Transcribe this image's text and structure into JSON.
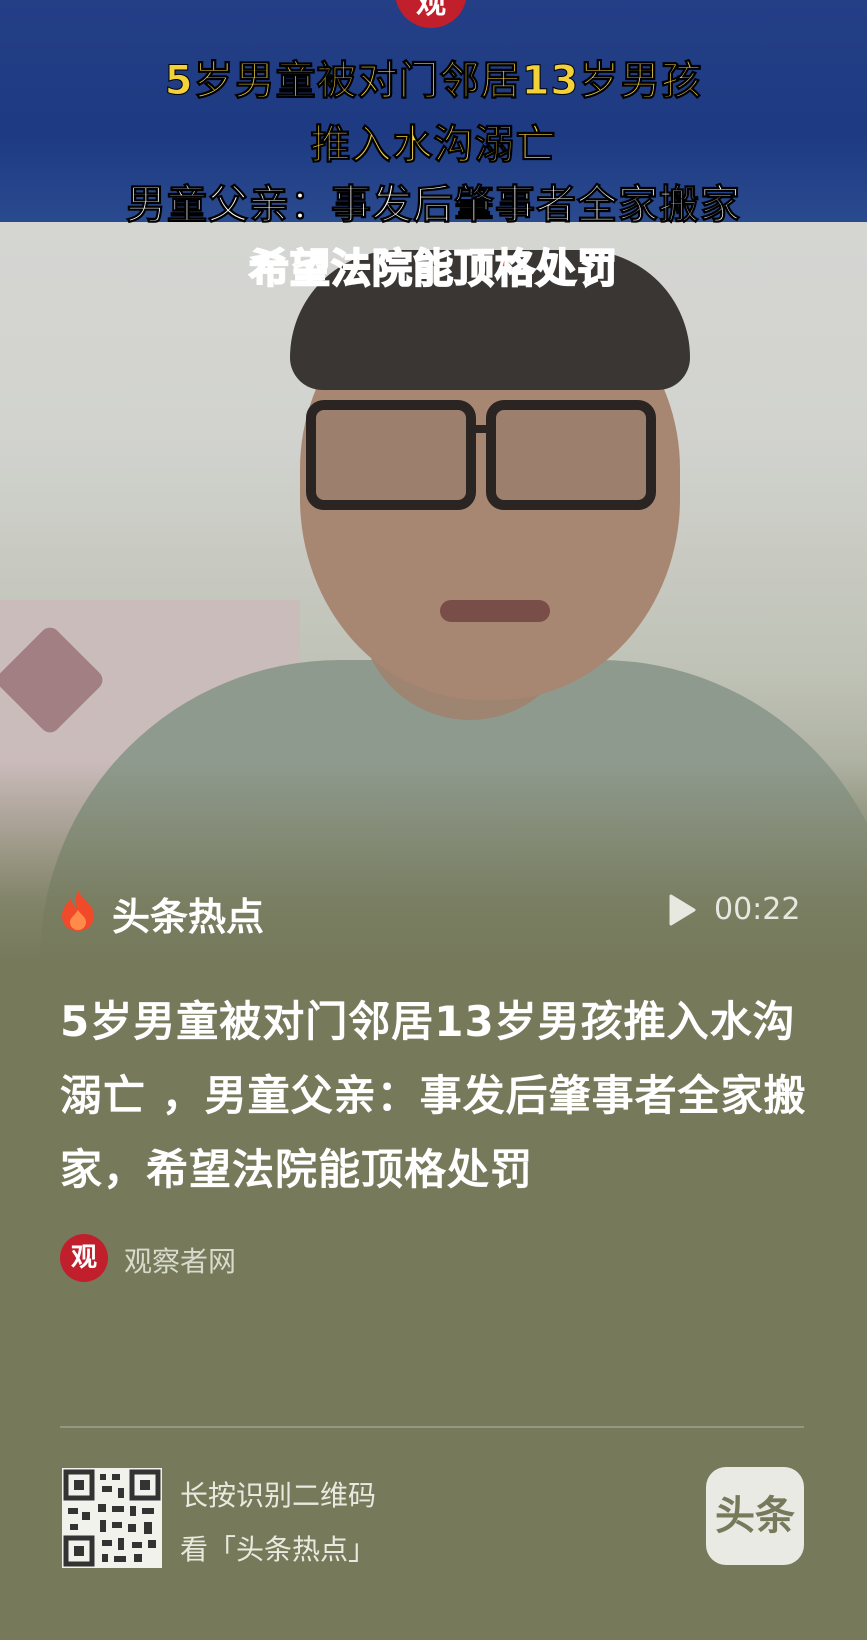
{
  "video": {
    "logo_text": "观",
    "headline_lines": [
      "5岁男童被对门邻居13岁男孩",
      "推入水沟溺亡",
      "男童父亲：事发后肇事者全家搬家",
      "希望法院能顶格处罚"
    ],
    "channel_label": "头条热点",
    "duration": "00:22"
  },
  "article": {
    "title": "5岁男童被对门邻居13岁男孩推入水沟溺亡 ，男童父亲：事发后肇事者全家搬家，希望法院能顶格处罚",
    "source_logo_text": "观",
    "source_name": "观察者网"
  },
  "footer": {
    "qr_line1": "长按识别二维码",
    "qr_line2": "看「头条热点」",
    "app_badge": "头条"
  },
  "colors": {
    "background": "#767a5b",
    "banner": "#1d3a82",
    "headline_yellow": "#f3d13a",
    "headline_red": "#f03b3b",
    "source_red": "#c21f2c"
  }
}
